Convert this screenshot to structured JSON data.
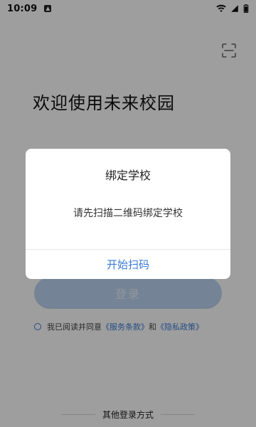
{
  "status_bar": {
    "time": "10:09"
  },
  "main": {
    "welcome_title": "欢迎使用未来校园",
    "login_label": "登录",
    "agreement": {
      "prefix": "我已阅读并同意",
      "terms": "《服务条款》",
      "and": "和",
      "privacy": "《隐私政策》"
    },
    "other_login": "其他登录方式"
  },
  "dialog": {
    "title": "绑定学校",
    "message": "请先扫描二维码绑定学校",
    "action_label": "开始扫码"
  },
  "colors": {
    "accent": "#3a7bd5",
    "overlay": "rgba(0,0,0,0.38)",
    "login_button_bg": "#bcd3f0"
  },
  "icons": {
    "status_app": "app-notification-icon",
    "wifi": "wifi-icon",
    "signal": "signal-icon",
    "battery": "battery-icon",
    "scan": "scan-icon"
  }
}
